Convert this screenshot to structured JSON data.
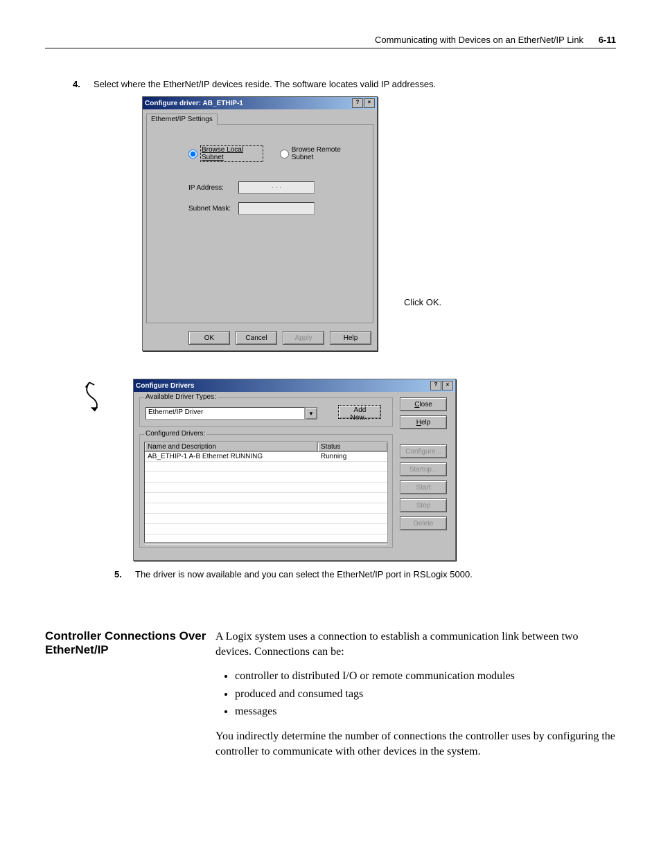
{
  "header": {
    "title": "Communicating with Devices on an EtherNet/IP Link",
    "page": "6-11"
  },
  "step4": {
    "num": "4.",
    "text": "Select where the EtherNet/IP devices reside. The software locates valid IP addresses."
  },
  "dialog1": {
    "title": "Configure driver: AB_ETHIP-1",
    "tab": "Ethernet/IP Settings",
    "radio_local": "Browse Local Subnet",
    "radio_remote": "Browse Remote Subnet",
    "lbl_ip": "IP Address:",
    "ip_value": ".       .       .",
    "lbl_mask": "Subnet Mask:",
    "mask_value": "",
    "btn_ok": "OK",
    "btn_cancel": "Cancel",
    "btn_apply": "Apply",
    "btn_help": "Help"
  },
  "callout": "Click OK.",
  "dialog2": {
    "title": "Configure Drivers",
    "grp_avail": "Available Driver Types:",
    "combo_value": "Ethernet/IP Driver",
    "btn_addnew": "Add New...",
    "grp_conf": "Configured Drivers:",
    "col1": "Name and Description",
    "col2": "Status",
    "row1_name": "AB_ETHIP-1  A-B Ethernet  RUNNING",
    "row1_status": "Running",
    "btn_close": "Close",
    "btn_help": "Help",
    "btn_configure": "Configure...",
    "btn_startup": "Startup...",
    "btn_start": "Start",
    "btn_stop": "Stop",
    "btn_delete": "Delete"
  },
  "step5": {
    "num": "5.",
    "text": "The driver is now available and you can select the EtherNet/IP port in RSLogix 5000."
  },
  "section": {
    "heading": "Controller Connections Over EtherNet/IP",
    "p1": "A Logix system uses a connection to establish a communication link between two devices. Connections can be:",
    "bul1": "controller to distributed I/O or remote communication modules",
    "bul2": "produced and consumed tags",
    "bul3": "messages",
    "p2": "You indirectly determine the number of connections the controller uses by configuring the controller to communicate with other devices in the system."
  }
}
